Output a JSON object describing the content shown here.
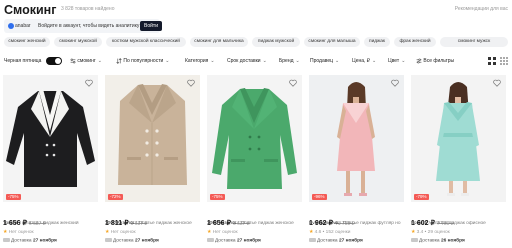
{
  "header": {
    "title": "Смокинг",
    "count": "3 828 товаров найдено",
    "recommendations": "Рекомендации для вас"
  },
  "login_bar": {
    "brand": "anabar",
    "text": "Войдите в аккаунт, чтобы видеть аналитику",
    "button": "Войти"
  },
  "chips": [
    "смокинг женский",
    "смокинг мужской",
    "костюм мужской классический",
    "смокинг для мальчика",
    "пиджак мужской",
    "смокинг для малыша",
    "пиджак",
    "фрак женский",
    "смокинг мужск"
  ],
  "filters": {
    "cheap_label": "Черная пятница",
    "items": [
      "смокинг",
      "По популярности",
      "Категория",
      "Срок доставки",
      "Бренд",
      "Продавец",
      "Цена, ₽",
      "Цвет",
      "Все фильтры"
    ]
  },
  "products": [
    {
      "discount": "-75%",
      "price": "1 656 ₽",
      "old_price": "6 637 ₽",
      "brand": "Тонкие",
      "title": "/ Платье - пиджак женский",
      "rating": "Нет оценок",
      "delivery_label": "Доставка",
      "delivery_date": "27 ноября"
    },
    {
      "discount": "-72%",
      "price": "1 811 ₽",
      "old_price": "6 637 ₽",
      "brand": "1000 Каталог",
      "title": "/ Платье пиджак женское",
      "rating": "Нет оценок",
      "delivery_label": "Доставка",
      "delivery_date": "27 ноября"
    },
    {
      "discount": "-75%",
      "price": "1 656 ₽",
      "old_price": "6 637 ₽",
      "brand": "1000 Каталог",
      "title": "/ Платье пиджак женское",
      "rating": "Нет оценок",
      "delivery_label": "Доставка",
      "delivery_date": "27 ноября"
    },
    {
      "discount": "-96%",
      "price": "1 962 ₽",
      "old_price": "41 798 ₽",
      "brand": "Eva Davidova",
      "title": "/ Платье пиджак футляр но",
      "rating": "4.6 • 152 оценки",
      "delivery_label": "Доставка",
      "delivery_date": "27 ноября"
    },
    {
      "discount": "-79%",
      "price": "1 602 ₽",
      "old_price": "7 759 ₽",
      "brand": "Forenni",
      "title": "/ Платье пиджак офисное",
      "rating": "3.4 • 29 оценок",
      "delivery_label": "Доставка",
      "delivery_date": "26 ноября"
    }
  ]
}
